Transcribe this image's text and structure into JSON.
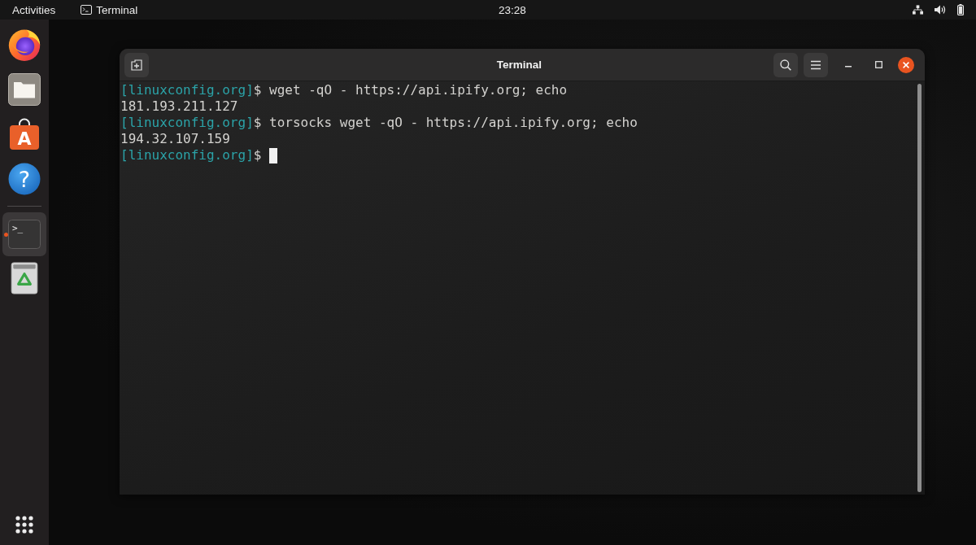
{
  "top_bar": {
    "activities": "Activities",
    "app_menu": "Terminal",
    "clock": "23:28"
  },
  "dock": {
    "favorites": [
      {
        "kind": "browser",
        "running": false,
        "selected": false
      },
      {
        "kind": "files",
        "running": false,
        "selected": false
      },
      {
        "kind": "store",
        "glyph": "A",
        "running": false,
        "selected": false
      },
      {
        "kind": "help",
        "glyph": "?",
        "running": false,
        "selected": false
      }
    ],
    "others": [
      {
        "kind": "terminal",
        "glyph": ">_",
        "running": true,
        "selected": true
      },
      {
        "kind": "trash",
        "running": false,
        "selected": false
      }
    ]
  },
  "window": {
    "title": "Terminal",
    "lines": [
      {
        "kind": "prompt",
        "prompt": "[linuxconfig.org]",
        "symbol": "$",
        "command": "wget -qO - https://api.ipify.org; echo",
        "cursor": false
      },
      {
        "kind": "output",
        "text": "181.193.211.127",
        "cursor": false
      },
      {
        "kind": "prompt",
        "prompt": "[linuxconfig.org]",
        "symbol": "$",
        "command": "torsocks wget -qO - https://api.ipify.org; echo",
        "cursor": false
      },
      {
        "kind": "output",
        "text": "194.32.107.159",
        "cursor": false
      },
      {
        "kind": "prompt",
        "prompt": "[linuxconfig.org]",
        "symbol": "$",
        "cursor": true
      }
    ]
  }
}
